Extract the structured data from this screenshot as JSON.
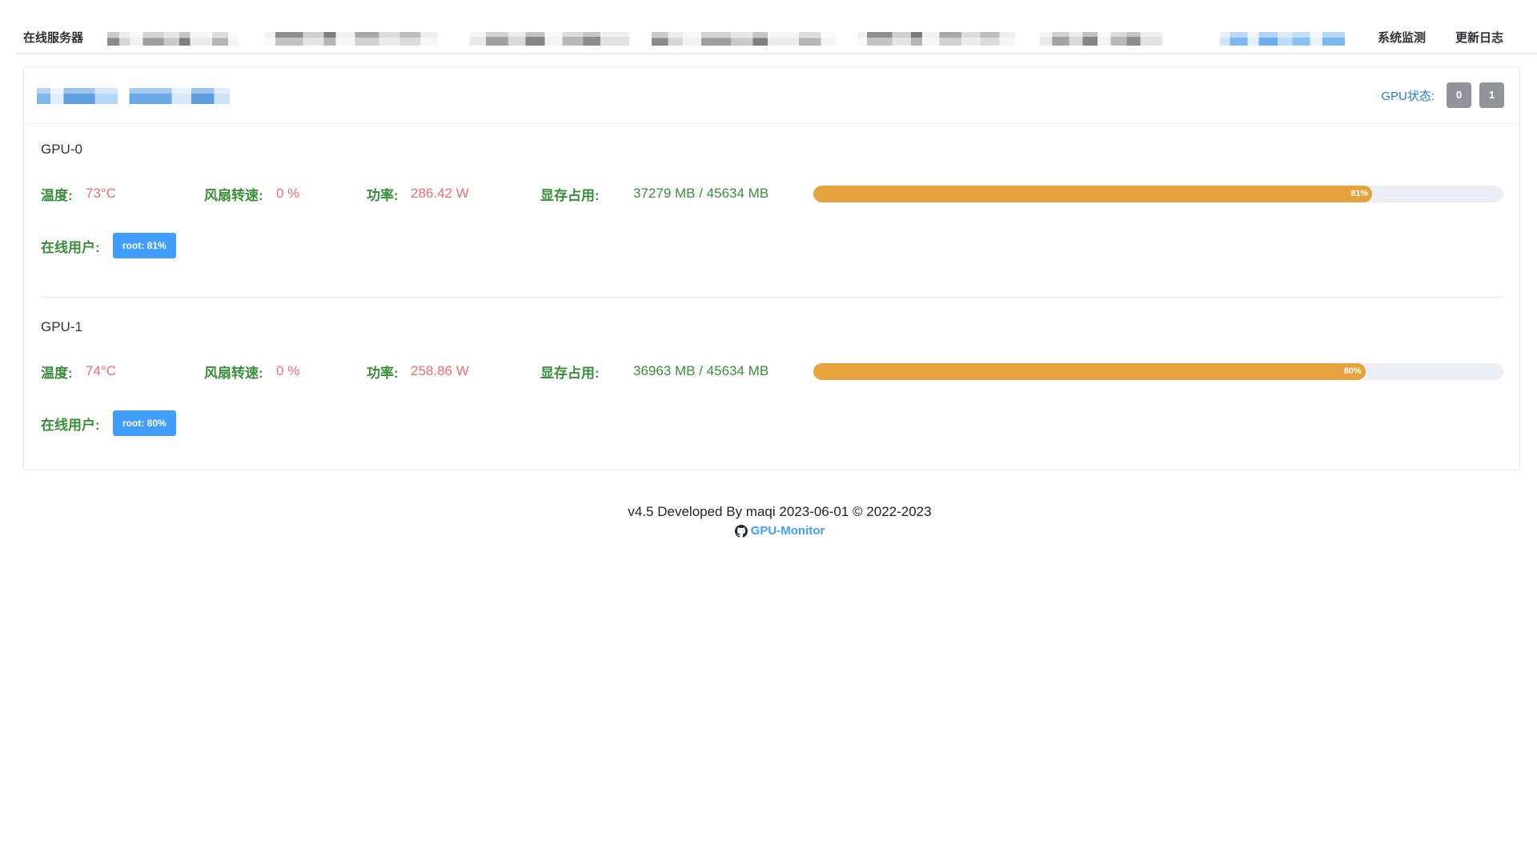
{
  "nav": {
    "servers_label": "在线服务器",
    "items": [
      {
        "label": "系统监测"
      },
      {
        "label": "更新日志"
      }
    ]
  },
  "server_card": {
    "gpu_status_label": "GPU状态:",
    "gpu_buttons": [
      "0",
      "1"
    ]
  },
  "gpus": [
    {
      "title": "GPU-0",
      "temperature_label": "温度:",
      "temperature": "73°C",
      "fan_label": "风扇转速:",
      "fan": "0 %",
      "power_label": "功率:",
      "power": "286.42 W",
      "memory_label": "显存占用:",
      "memory": "37279 MB / 45634 MB",
      "memory_percent": 81,
      "memory_percent_text": "81%",
      "users_label": "在线用户:",
      "users": [
        "root: 81%"
      ]
    },
    {
      "title": "GPU-1",
      "temperature_label": "温度:",
      "temperature": "74°C",
      "fan_label": "风扇转速:",
      "fan": "0 %",
      "power_label": "功率:",
      "power": "258.86 W",
      "memory_label": "显存占用:",
      "memory": "36963 MB / 45634 MB",
      "memory_percent": 80,
      "memory_percent_text": "80%",
      "users_label": "在线用户:",
      "users": [
        "root: 80%"
      ]
    }
  ],
  "footer": {
    "credit": "v4.5 Developed By maqi 2023-06-01 © 2022-2023",
    "repo_link": "GPU-Monitor"
  },
  "icons": {
    "repo_link": "github-icon"
  },
  "colors": {
    "accent": "#409eff",
    "label_green": "#3a8d3a",
    "value_red": "#f56c6c",
    "progress_fill": "#e6a23c",
    "progress_track": "#ebeef5",
    "button_gray": "#909399",
    "status_blue": "#1e7ad6"
  }
}
